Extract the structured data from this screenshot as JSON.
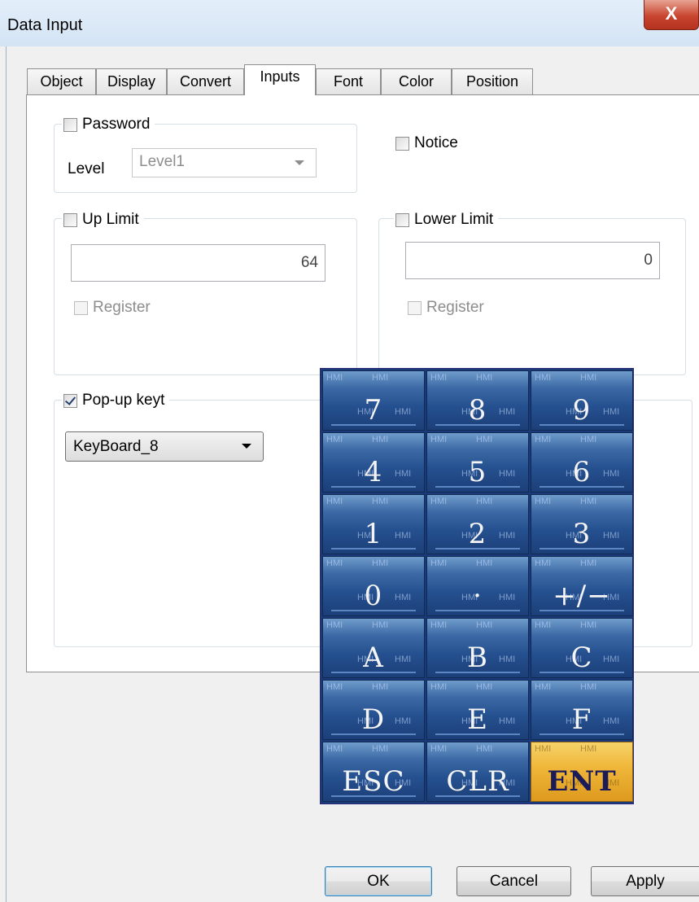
{
  "window": {
    "title": "Data Input",
    "close_glyph": "X"
  },
  "tabs": [
    {
      "label": "Object"
    },
    {
      "label": "Display"
    },
    {
      "label": "Convert"
    },
    {
      "label": "Inputs",
      "active": true
    },
    {
      "label": "Font"
    },
    {
      "label": "Color"
    },
    {
      "label": "Position"
    }
  ],
  "password": {
    "label": "Password",
    "checked": false,
    "level_label": "Level",
    "level_value": "Level1"
  },
  "notice": {
    "label": "Notice",
    "checked": false
  },
  "up_limit": {
    "label": "Up Limit",
    "checked": false,
    "value": "64",
    "register_label": "Register"
  },
  "lower_limit": {
    "label": "Lower Limit",
    "checked": false,
    "value": "0",
    "register_label": "Register"
  },
  "popup": {
    "label": "Pop-up keyt",
    "checked": true,
    "keyboard_value": "KeyBoard_8"
  },
  "keypad": {
    "watermark": "HMI",
    "keys": [
      "7",
      "8",
      "9",
      "4",
      "5",
      "6",
      "1",
      "2",
      "3",
      "0",
      "·",
      "+/−",
      "A",
      "B",
      "C",
      "D",
      "E",
      "F",
      "ESC",
      "CLR",
      "ENT"
    ]
  },
  "buttons": {
    "ok": "OK",
    "cancel": "Cancel",
    "apply": "Apply"
  }
}
